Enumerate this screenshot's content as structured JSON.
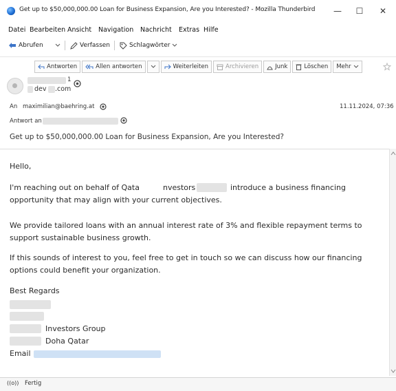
{
  "window": {
    "title": "Get up to $50,000,000.00 Loan for Business Expansion, Are you Interested? - Mozilla Thunderbird",
    "minimize": "—",
    "maximize": "☐",
    "close": "✕"
  },
  "menu": [
    "Datei",
    "Bearbeiten",
    "Ansicht",
    "Navigation",
    "Nachricht",
    "Extras",
    "Hilfe"
  ],
  "toolbar": {
    "abrufen": "Abrufen",
    "verfassen": "Verfassen",
    "schlagwoerter": "Schlagwörter"
  },
  "actions": {
    "antworten": "Antworten",
    "allen_antworten": "Allen antworten",
    "weiterleiten": "Weiterleiten",
    "archivieren": "Archivieren",
    "junk": "Junk",
    "loeschen": "Löschen",
    "mehr": "Mehr"
  },
  "header": {
    "sender_name_partial": "1",
    "sender_email_partial": "dev",
    "sender_email_tail": ".com",
    "to_label": "An",
    "to_value": "maximilian@baehring.at",
    "date": "11.11.2024, 07:36",
    "reply_to_label": "Antwort an",
    "subject": "Get up to $50,000,000.00 Loan for Business Expansion, Are you Interested?"
  },
  "body": {
    "greeting": "Hello,",
    "p1_line1_a": "I'm reaching out on behalf of Qata",
    "p1_line1_b": "nvestors",
    "p1_line1_c": "introduce a business financing",
    "p1_line2": "opportunity that may align with your current objectives.",
    "p2_line1": "We provide tailored loans with an annual interest rate of 3% and flexible repayment terms to",
    "p2_line2": "support sustainable business growth.",
    "p3_line1": "If this sounds of interest to you, feel free to get in touch so we can discuss how our financing",
    "p3_line2": "options could benefit your organization.",
    "signoff": "Best Regards",
    "sig_group": "Investors Group",
    "sig_location": "Doha Qatar",
    "sig_email_label": "Email"
  },
  "status": {
    "text": "Fertig",
    "icon": "((o))"
  }
}
